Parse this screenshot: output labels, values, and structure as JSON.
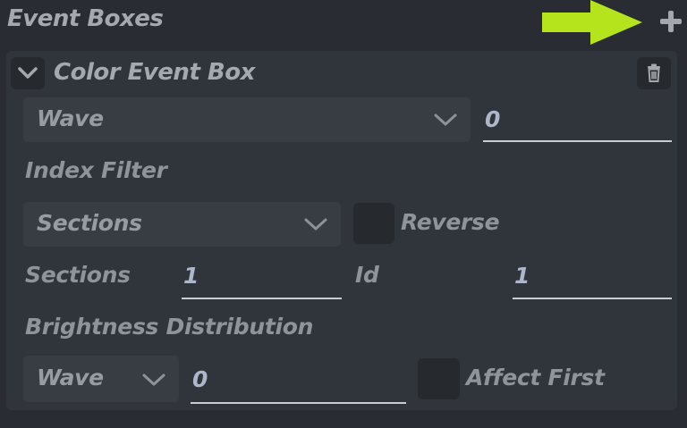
{
  "header": {
    "title": "Event Boxes"
  },
  "event_box": {
    "title": "Color Event Box",
    "type_select": {
      "value": "Wave"
    },
    "type_value": "0",
    "index_filter": {
      "label": "Index Filter",
      "filter_select": {
        "value": "Sections"
      },
      "reverse_label": "Reverse",
      "sections_label": "Sections",
      "sections_value": "1",
      "id_label": "Id",
      "id_value": "1"
    },
    "brightness": {
      "label": "Brightness Distribution",
      "select": {
        "value": "Wave"
      },
      "value": "0",
      "affect_first_label": "Affect First"
    }
  },
  "colors": {
    "arrow": "#b5e31c",
    "background": "#292d33",
    "panel": "#30343b"
  }
}
